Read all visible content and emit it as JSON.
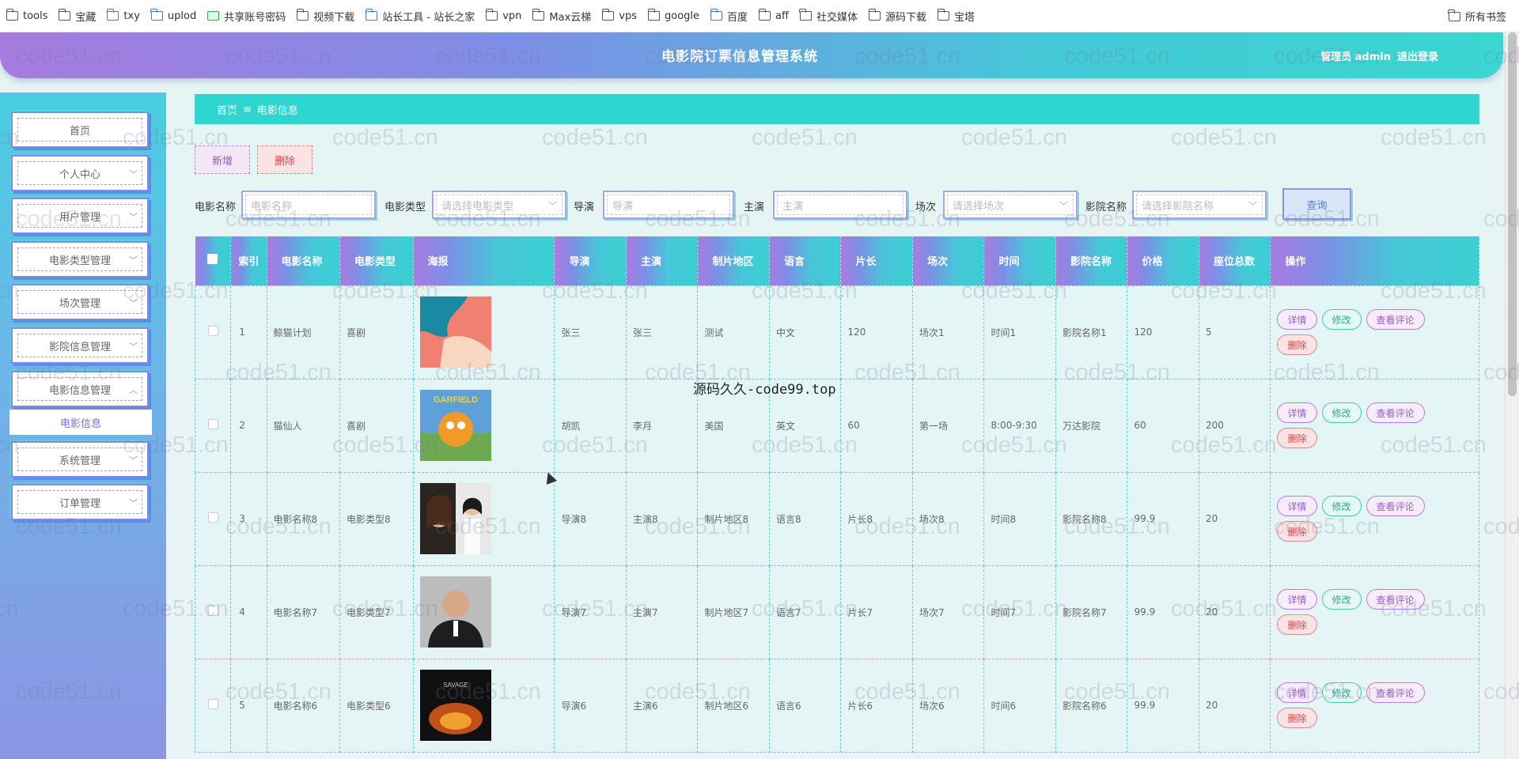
{
  "bookmarks": [
    {
      "label": "tools",
      "icon": "folder-icon"
    },
    {
      "label": "宝藏",
      "icon": "folder-icon"
    },
    {
      "label": "txy",
      "icon": "cloud-icon"
    },
    {
      "label": "uplod",
      "icon": "cloud-icon"
    },
    {
      "label": "共享账号密码",
      "icon": "sheet-icon"
    },
    {
      "label": "视频下载",
      "icon": "folder-icon"
    },
    {
      "label": "站长工具 - 站长之家",
      "icon": "site-icon"
    },
    {
      "label": "vpn",
      "icon": "folder-icon"
    },
    {
      "label": "Max云梯",
      "icon": "folder-icon"
    },
    {
      "label": "vps",
      "icon": "folder-icon"
    },
    {
      "label": "google",
      "icon": "folder-icon"
    },
    {
      "label": "百度",
      "icon": "baidu-icon"
    },
    {
      "label": "aff",
      "icon": "folder-icon"
    },
    {
      "label": "社交媒体",
      "icon": "folder-icon"
    },
    {
      "label": "源码下载",
      "icon": "folder-icon"
    },
    {
      "label": "宝塔",
      "icon": "folder-icon"
    }
  ],
  "bookmarks_right": "所有书签",
  "header": {
    "title": "电影院订票信息管理系统",
    "user": "管理员 admin",
    "logout": "退出登录"
  },
  "sidebar": {
    "items": [
      {
        "label": "首页",
        "has_chevron": false
      },
      {
        "label": "个人中心",
        "has_chevron": true
      },
      {
        "label": "用户管理",
        "has_chevron": true
      },
      {
        "label": "电影类型管理",
        "has_chevron": true
      },
      {
        "label": "场次管理",
        "has_chevron": true
      },
      {
        "label": "影院信息管理",
        "has_chevron": true
      },
      {
        "label": "电影信息管理",
        "has_chevron": true
      },
      {
        "label": "系统管理",
        "has_chevron": true
      },
      {
        "label": "订单管理",
        "has_chevron": true
      }
    ],
    "submenu": "电影信息"
  },
  "breadcrumb": {
    "home": "首页",
    "separator": "≡",
    "current": "电影信息"
  },
  "actions": {
    "add": "新增",
    "delete": "删除"
  },
  "search": {
    "fields": [
      {
        "label": "电影名称",
        "placeholder": "电影名称",
        "type": "input"
      },
      {
        "label": "电影类型",
        "placeholder": "请选择电影类型",
        "type": "select"
      },
      {
        "label": "导演",
        "placeholder": "导演",
        "type": "input"
      },
      {
        "label": "主演",
        "placeholder": "主演",
        "type": "input"
      },
      {
        "label": "场次",
        "placeholder": "请选择场次",
        "type": "select"
      },
      {
        "label": "影院名称",
        "placeholder": "请选择影院名称",
        "type": "select"
      }
    ],
    "query": "查询"
  },
  "table": {
    "columns": [
      "索引",
      "电影名称",
      "电影类型",
      "海报",
      "导演",
      "主演",
      "制片地区",
      "语言",
      "片长",
      "场次",
      "时间",
      "影院名称",
      "价格",
      "座位总数",
      "操作"
    ],
    "op_labels": {
      "detail": "详情",
      "edit": "修改",
      "review": "查看评论",
      "remove": "删除"
    },
    "rows": [
      {
        "idx": "1",
        "name": "鲸猫计划",
        "type": "喜剧",
        "poster": "poster-abstract",
        "director": "张三",
        "actor": "张三",
        "region": "测试",
        "lang": "中文",
        "length": "120",
        "session": "场次1",
        "time": "时间1",
        "cinema": "影院名称1",
        "price": "120",
        "seats": "5"
      },
      {
        "idx": "2",
        "name": "猫仙人",
        "type": "喜剧",
        "poster": "poster-garfield",
        "director": "胡凯",
        "actor": "李月",
        "region": "美国",
        "lang": "英文",
        "length": "60",
        "session": "第一场",
        "time": "8:00-9:30",
        "cinema": "万达影院",
        "price": "60",
        "seats": "200"
      },
      {
        "idx": "3",
        "name": "电影名称8",
        "type": "电影类型8",
        "poster": "poster-portrait",
        "director": "导演8",
        "actor": "主演8",
        "region": "制片地区8",
        "lang": "语言8",
        "length": "片长8",
        "session": "场次8",
        "time": "时间8",
        "cinema": "影院名称8",
        "price": "99.9",
        "seats": "20"
      },
      {
        "idx": "4",
        "name": "电影名称7",
        "type": "电影类型7",
        "poster": "poster-man",
        "director": "导演7",
        "actor": "主演7",
        "region": "制片地区7",
        "lang": "语言7",
        "length": "片长7",
        "session": "场次7",
        "time": "时间7",
        "cinema": "影院名称7",
        "price": "99.9",
        "seats": "20"
      },
      {
        "idx": "5",
        "name": "电影名称6",
        "type": "电影类型6",
        "poster": "poster-fire",
        "director": "导演6",
        "actor": "主演6",
        "region": "制片地区6",
        "lang": "语言6",
        "length": "片长6",
        "session": "场次6",
        "time": "时间6",
        "cinema": "影院名称6",
        "price": "99.9",
        "seats": "20"
      }
    ]
  },
  "overlay_text": "源码久久-code99.top",
  "watermark": "code51.cn",
  "colors": {
    "accent": "#2ed6cf",
    "purple": "#a77be0",
    "danger": "#d24e4e"
  }
}
